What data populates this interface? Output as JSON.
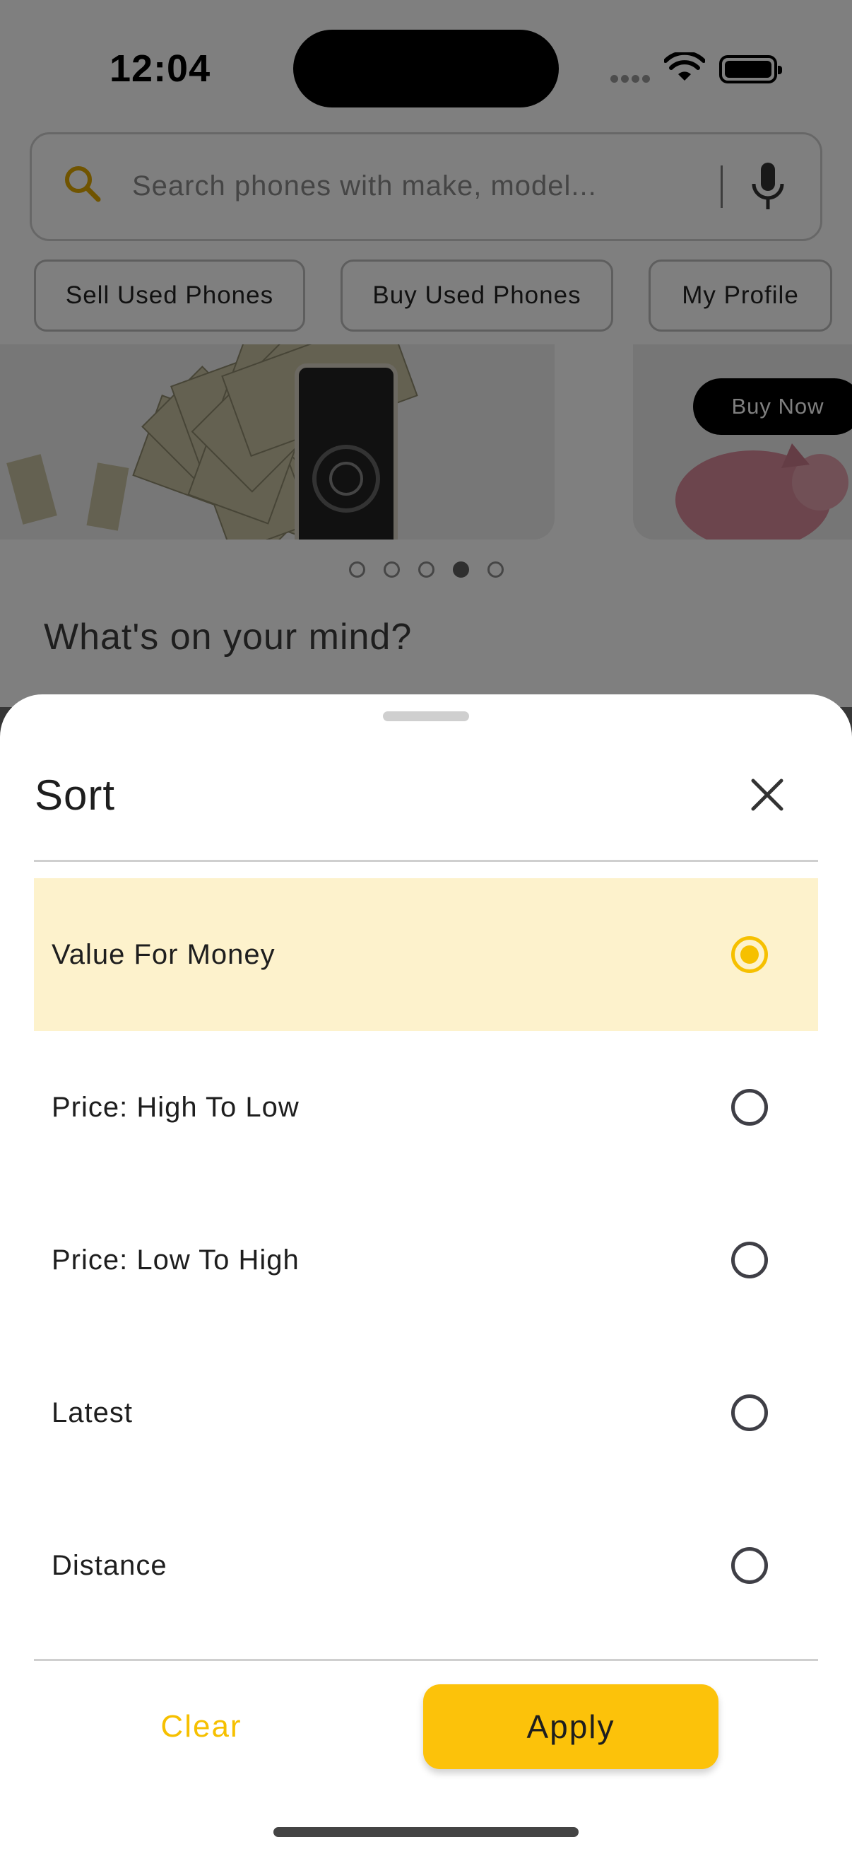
{
  "status_bar": {
    "time": "12:04"
  },
  "search": {
    "placeholder": "Search phones with make, model..."
  },
  "chips": [
    {
      "label": "Sell Used Phones"
    },
    {
      "label": "Buy Used Phones"
    },
    {
      "label": "My Profile"
    }
  ],
  "banner": {
    "buy_now_label": "Buy Now",
    "active_dot": 4,
    "dot_count": 5
  },
  "section": {
    "title": "What's on your mind?"
  },
  "sheet": {
    "title": "Sort",
    "options": [
      {
        "label": "Value For Money",
        "selected": true
      },
      {
        "label": "Price: High To Low",
        "selected": false
      },
      {
        "label": "Price: Low To High",
        "selected": false
      },
      {
        "label": "Latest",
        "selected": false
      },
      {
        "label": "Distance",
        "selected": false
      }
    ],
    "clear_label": "Clear",
    "apply_label": "Apply"
  },
  "colors": {
    "accent": "#fcc20a",
    "selected_row": "#fdf2cc"
  }
}
